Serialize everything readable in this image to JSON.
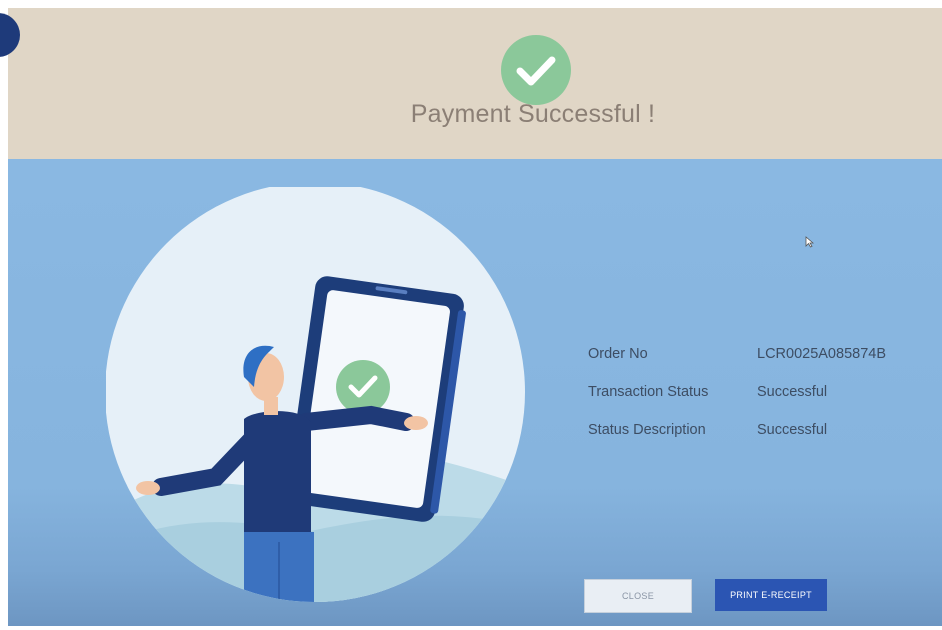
{
  "header": {
    "title": "Payment Successful !",
    "icon": "check-circle-icon"
  },
  "details": [
    {
      "label": "Order No",
      "value": "LCR0025A085874B"
    },
    {
      "label": "Transaction Status",
      "value": "Successful"
    },
    {
      "label": "Status Description",
      "value": "Successful"
    }
  ],
  "buttons": {
    "close_label": "CLOSE",
    "print_label": "PRINT E-RECEIPT"
  },
  "colors": {
    "header_bg": "#e0d6c6",
    "content_bg": "#8ab8e2",
    "success_green": "#8bc89a",
    "primary_button": "#2b55b3"
  }
}
